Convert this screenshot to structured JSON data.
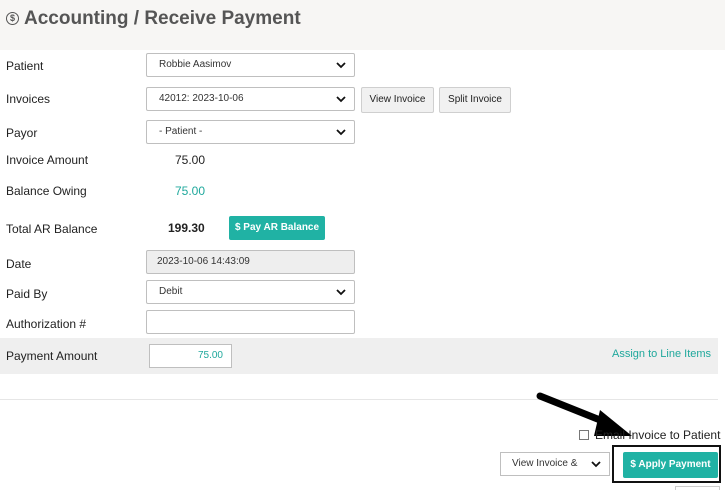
{
  "header": {
    "title": "Accounting / Receive Payment",
    "icon": "dollar-circle-icon"
  },
  "form": {
    "patient": {
      "label": "Patient",
      "value": "Robbie Aasimov"
    },
    "invoices": {
      "label": "Invoices",
      "value": "42012: 2023-10-06",
      "view_invoice_label": "View Invoice",
      "split_invoice_label": "Split Invoice"
    },
    "payor": {
      "label": "Payor",
      "value": "- Patient -"
    },
    "invoice_amount": {
      "label": "Invoice Amount",
      "value": "75.00"
    },
    "balance_owing": {
      "label": "Balance Owing",
      "value": "75.00"
    },
    "total_ar_balance": {
      "label": "Total AR Balance",
      "value": "199.30",
      "pay_button_label": "$ Pay AR Balance"
    },
    "date": {
      "label": "Date",
      "value": "2023-10-06 14:43:09"
    },
    "paid_by": {
      "label": "Paid By",
      "value": "Debit"
    },
    "authorization": {
      "label": "Authorization #",
      "value": ""
    },
    "payment_amount": {
      "label": "Payment Amount",
      "value": "75.00",
      "assign_link": "Assign to Line Items"
    }
  },
  "footer": {
    "email_invoice_label": "Email Invoice to Patient",
    "email_invoice_checked": false,
    "view_invoice_select": "View Invoice &",
    "apply_payment_label": "$ Apply Payment"
  },
  "colors": {
    "accent": "#20b2a4",
    "link": "#1fa89c",
    "header_bg": "#f7f6f4",
    "row_bg": "#efefef"
  }
}
